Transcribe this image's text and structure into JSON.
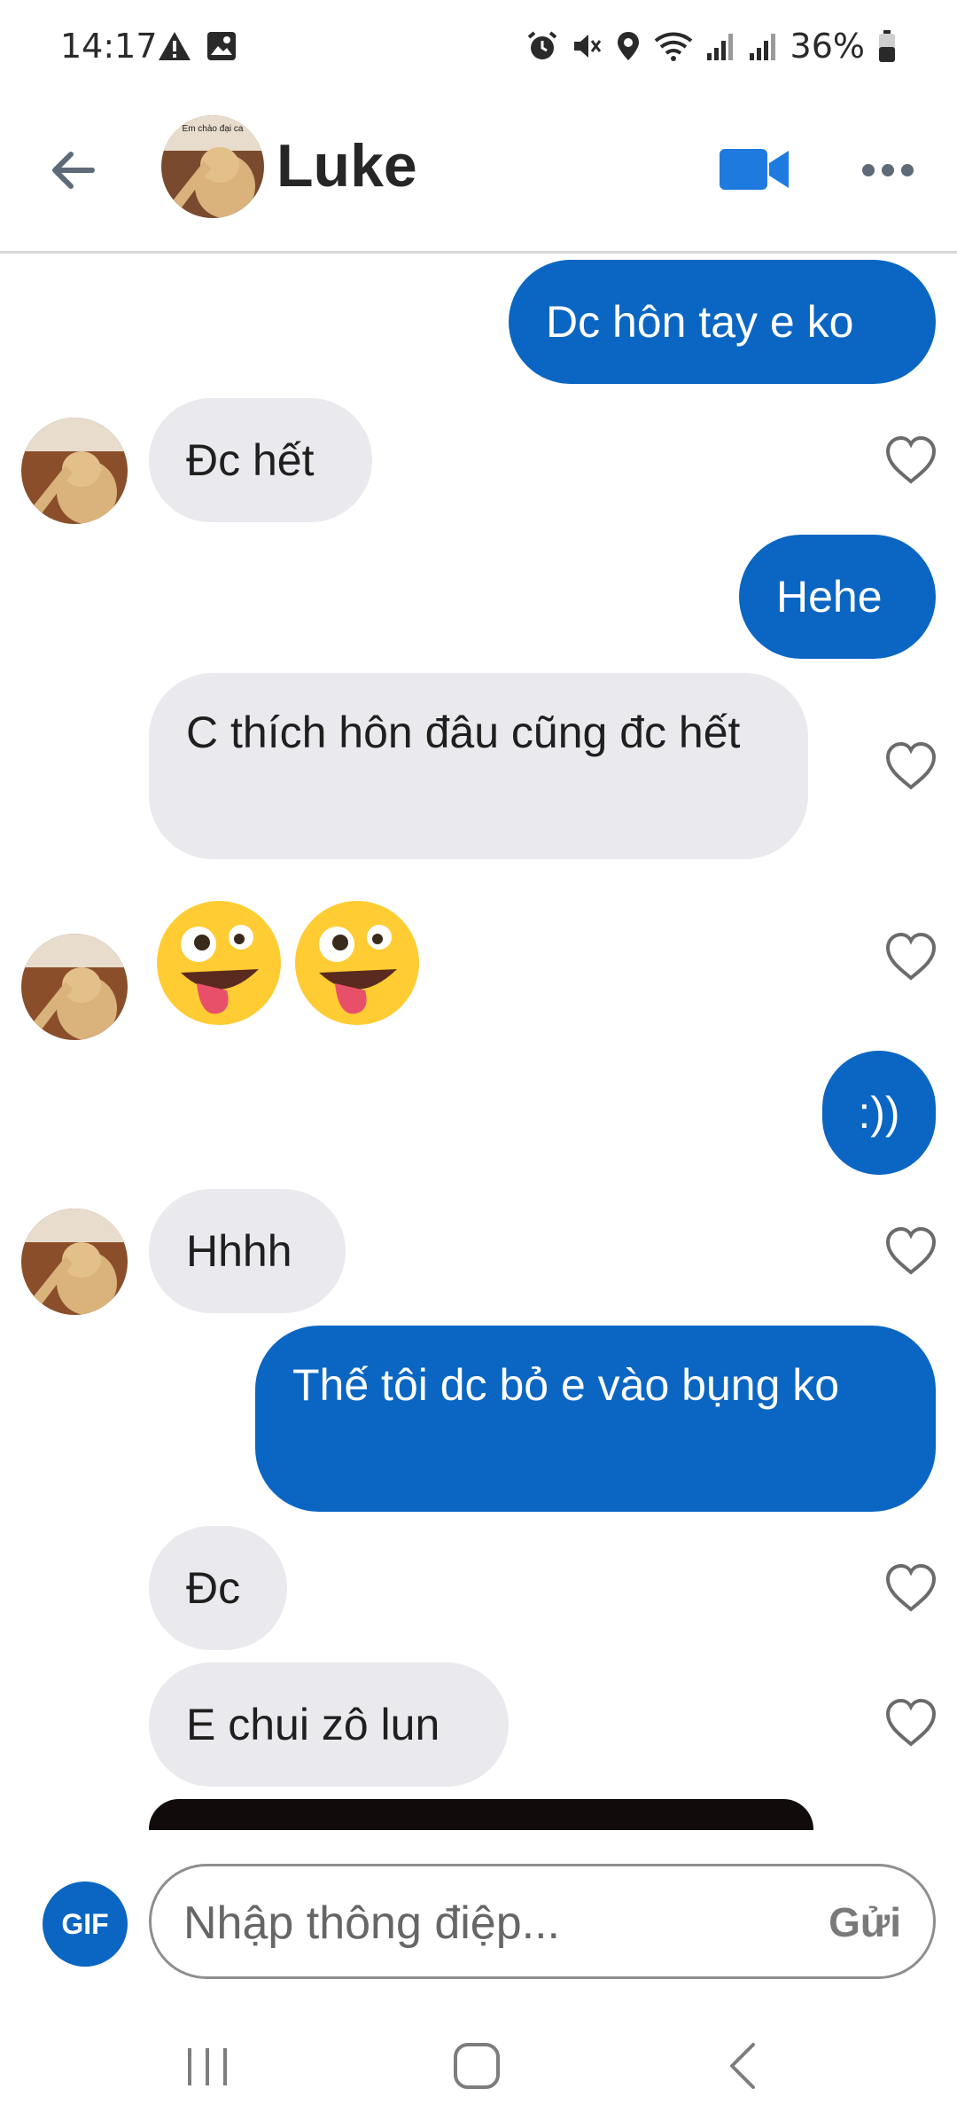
{
  "status_bar": {
    "time": "14:17",
    "battery": "36%",
    "icons": [
      "warning-icon",
      "image-icon",
      "alarm-icon",
      "mute-icon",
      "location-icon",
      "wifi-icon",
      "signal-icon",
      "signal-icon",
      "battery-icon"
    ]
  },
  "header": {
    "contact_name": "Luke",
    "avatar_caption": "Em chào đại ca"
  },
  "messages": [
    {
      "dir": "out",
      "text": "Dc hôn tay e ko"
    },
    {
      "dir": "in",
      "text": "Đc hết"
    },
    {
      "dir": "out",
      "text": "Hehe"
    },
    {
      "dir": "in",
      "text": "C thích hôn đâu cũng đc hết"
    },
    {
      "dir": "in",
      "type": "emoji",
      "text": "🤪🤪"
    },
    {
      "dir": "out",
      "text": ":))"
    },
    {
      "dir": "in",
      "text": "Hhhh"
    },
    {
      "dir": "out",
      "text": "Thế tôi dc bỏ e vào bụng ko"
    },
    {
      "dir": "in",
      "text": "Đc"
    },
    {
      "dir": "in",
      "text": "E chui zô lun"
    }
  ],
  "composer": {
    "gif_label": "GIF",
    "placeholder": "Nhập thông điệp...",
    "send_label": "Gửi"
  },
  "colors": {
    "outgoing_bubble": "#0a66c2",
    "incoming_bubble": "#e9e9ee",
    "accent": "#0a66c2"
  }
}
